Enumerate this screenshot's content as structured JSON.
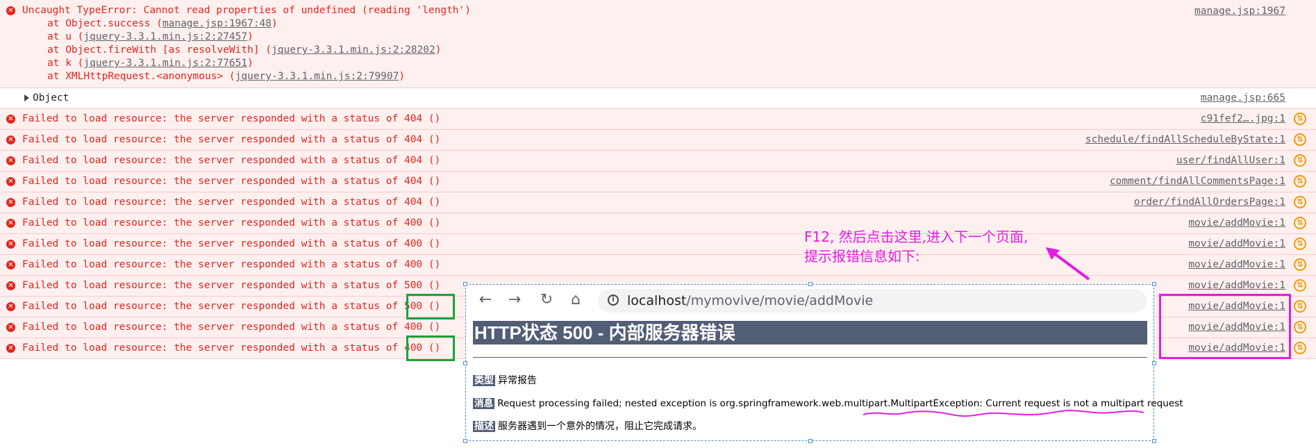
{
  "console": {
    "uncaught_error": {
      "message": "Uncaught TypeError: Cannot read properties of undefined (reading 'length')",
      "source": "manage.jsp:1967",
      "stack": [
        {
          "prefix": "at Object.success (",
          "link": "manage.jsp:1967:48",
          "suffix": ")"
        },
        {
          "prefix": "at u (",
          "link": "jquery-3.3.1.min.js:2:27457",
          "suffix": ")"
        },
        {
          "prefix": "at Object.fireWith [as resolveWith] (",
          "link": "jquery-3.3.1.min.js:2:28202",
          "suffix": ")"
        },
        {
          "prefix": "at k (",
          "link": "jquery-3.3.1.min.js:2:77651",
          "suffix": ")"
        },
        {
          "prefix": "at XMLHttpRequest.<anonymous> (",
          "link": "jquery-3.3.1.min.js:2:79907",
          "suffix": ")"
        }
      ]
    },
    "object_row": {
      "label": "Object",
      "source": "manage.jsp:665"
    },
    "resource_errors": [
      {
        "message": "Failed to load resource: the server responded with a status of 404 ()",
        "source": "c91fef2….jpg:1"
      },
      {
        "message": "Failed to load resource: the server responded with a status of 404 ()",
        "source": "schedule/findAllScheduleByState:1"
      },
      {
        "message": "Failed to load resource: the server responded with a status of 404 ()",
        "source": "user/findAllUser:1"
      },
      {
        "message": "Failed to load resource: the server responded with a status of 404 ()",
        "source": "comment/findAllCommentsPage:1"
      },
      {
        "message": "Failed to load resource: the server responded with a status of 404 ()",
        "source": "order/findAllOrdersPage:1"
      },
      {
        "message": "Failed to load resource: the server responded with a status of 400 ()",
        "source": "movie/addMovie:1"
      },
      {
        "message": "Failed to load resource: the server responded with a status of 400 ()",
        "source": "movie/addMovie:1"
      },
      {
        "message": "Failed to load resource: the server responded with a status of 400 ()",
        "source": "movie/addMovie:1"
      },
      {
        "message": "Failed to load resource: the server responded with a status of 500 ()",
        "source": "movie/addMovie:1"
      },
      {
        "message": "Failed to load resource: the server responded with a status of 500 ()",
        "source": "movie/addMovie:1"
      },
      {
        "message": "Failed to load resource: the server responded with a status of 400 ()",
        "source": "movie/addMovie:1"
      },
      {
        "message": "Failed to load resource: the server responded with a status of 400 ()",
        "source": "movie/addMovie:1"
      }
    ],
    "error_icon": "error-circle-icon",
    "network_icon": "network-request-icon"
  },
  "annotation": {
    "text": "F12, 然后点击这里,进入下一个页面,\n提示报错信息如下:",
    "color": "#e31ce3"
  },
  "inset_browser": {
    "url_host": "localhost",
    "url_path": "/mymovive/movie/addMovie",
    "title": "HTTP状态 500 - 内部服务器错误",
    "type_tag": "类型",
    "type_text": "异常报告",
    "message_tag": "消息",
    "message_text": "Request processing failed; nested exception is org.springframework.web.multipart.MultipartException: Current request is not a multipart request",
    "desc_tag": "描述",
    "desc_text": "服务器遇到一个意外的情况，阻止它完成请求。"
  },
  "colors": {
    "error_text": "#e1261c",
    "error_bg": "#fff0f0",
    "highlight_green": "#1aa33b",
    "highlight_magenta": "#e31ce3",
    "tomcat_header": "#525d76"
  }
}
